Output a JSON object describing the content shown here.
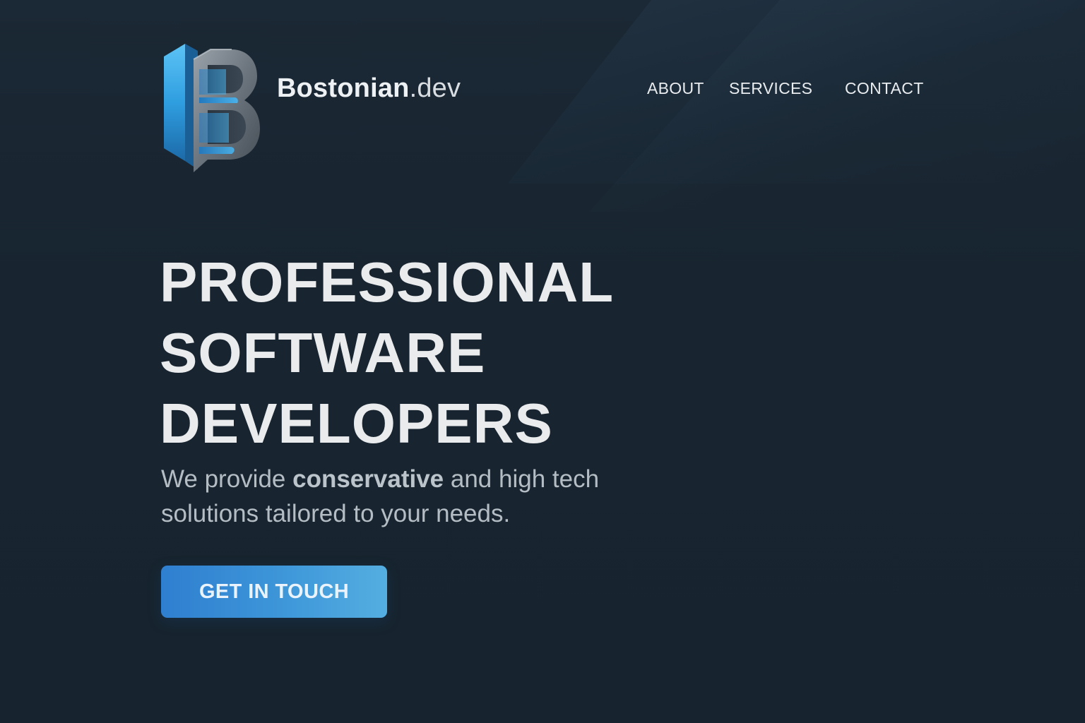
{
  "brand": {
    "name": "Bostonian",
    "tld": ".dev",
    "logo_icon": "b-monogram-logo-icon",
    "accent_color": "#3a9ad9"
  },
  "nav": {
    "items": [
      {
        "label": "ABOUT"
      },
      {
        "label": "SERVICES"
      },
      {
        "label": "CONTACT"
      }
    ]
  },
  "hero": {
    "title_lines": [
      "PROFESSIONAL",
      "SOFTWARE",
      "DEVELOPERS"
    ],
    "subtitle_pre": "We provide ",
    "subtitle_bold": "conservative",
    "subtitle_post": " and high tech solutions tailored to your needs.",
    "cta_label": "GET IN TOUCH"
  },
  "colors": {
    "background": "#182530",
    "cta_start": "#2f7fd0",
    "cta_end": "#55aee0",
    "title_text": "#e9ebed",
    "subtitle_text": "#b4bcc4"
  }
}
